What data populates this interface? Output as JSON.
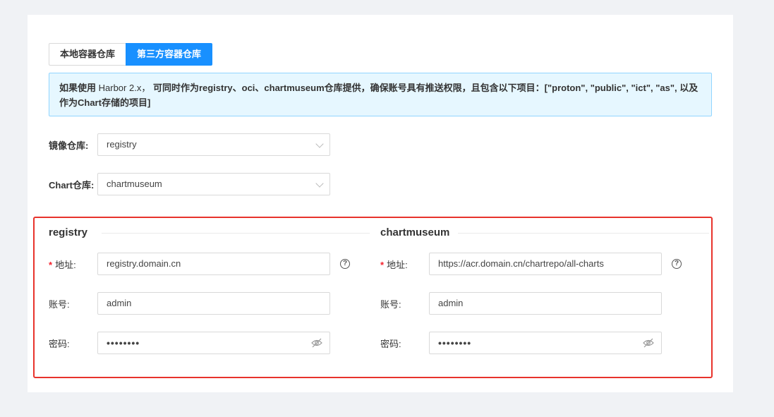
{
  "tabs": [
    {
      "label": "本地容器仓库",
      "active": false
    },
    {
      "label": "第三方容器仓库",
      "active": true
    }
  ],
  "notice": {
    "text_bold_start": "如果使用",
    "text_normal": " Harbor 2.x， ",
    "text_rest": "可同时作为registry、oci、chartmuseum仓库提供，确保账号具有推送权限，且包含以下项目：[\"proton\", \"public\", \"ict\", \"as\", 以及作为Chart存储的项目]"
  },
  "image_repo": {
    "label": "镜像仓库:",
    "value": "registry"
  },
  "chart_repo": {
    "label": "Chart仓库:",
    "value": "chartmuseum"
  },
  "registry": {
    "title": "registry",
    "address_label": "地址:",
    "address_value": "registry.domain.cn",
    "account_label": "账号:",
    "account_value": "admin",
    "password_label": "密码:",
    "password_value": "••••••••"
  },
  "chartmuseum": {
    "title": "chartmuseum",
    "address_label": "地址:",
    "address_value": "https://acr.domain.cn/chartrepo/all-charts",
    "account_label": "账号:",
    "account_value": "admin",
    "password_label": "密码:",
    "password_value": "••••••••"
  },
  "help_icon_glyph": "?",
  "required_mark": "*",
  "colors": {
    "accent": "#1890ff",
    "highlight_border": "#e8332c",
    "notice_bg": "#e6f7ff"
  }
}
